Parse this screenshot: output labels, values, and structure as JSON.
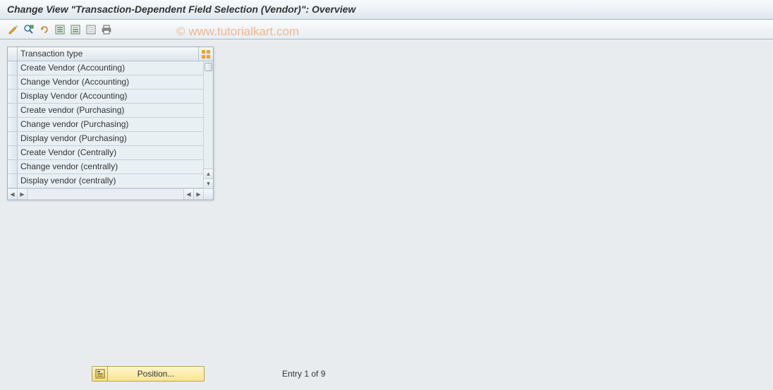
{
  "title": "Change View \"Transaction-Dependent Field Selection (Vendor)\": Overview",
  "watermark": "© www.tutorialkart.com",
  "toolbar": {
    "icons": [
      {
        "name": "change-display-toggle"
      },
      {
        "name": "other-view"
      },
      {
        "name": "undo-icon"
      },
      {
        "name": "select-all-icon"
      },
      {
        "name": "select-block-icon"
      },
      {
        "name": "deselect-all-icon"
      },
      {
        "name": "print-icon"
      }
    ]
  },
  "table": {
    "header": "Transaction type",
    "rows": [
      "Create Vendor (Accounting)",
      "Change Vendor (Accounting)",
      "Display Vendor (Accounting)",
      "Create vendor (Purchasing)",
      "Change vendor (Purchasing)",
      "Display vendor (Purchasing)",
      "Create Vendor (Centrally)",
      "Change vendor (centrally)",
      "Display vendor (centrally)"
    ]
  },
  "footer": {
    "position_label": "Position...",
    "entry_text": "Entry 1 of 9"
  }
}
